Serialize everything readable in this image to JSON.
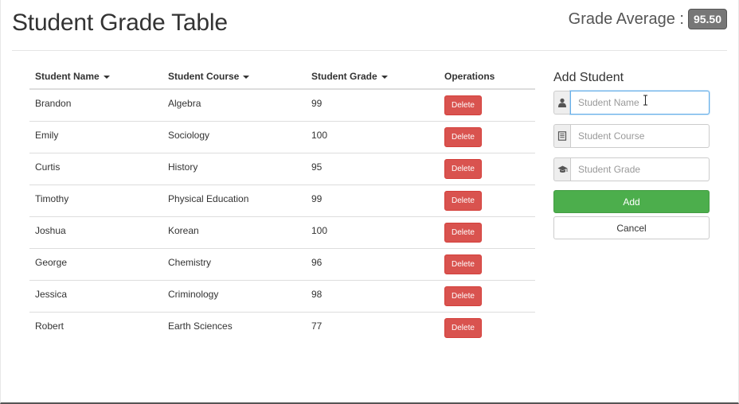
{
  "header": {
    "title": "Student Grade Table",
    "average_label": "Grade Average :",
    "average_value": "95.50"
  },
  "table": {
    "columns": [
      "Student Name",
      "Student Course",
      "Student Grade",
      "Operations"
    ],
    "rows": [
      {
        "name": "Brandon",
        "course": "Algebra",
        "grade": "99",
        "action": "Delete"
      },
      {
        "name": "Emily",
        "course": "Sociology",
        "grade": "100",
        "action": "Delete"
      },
      {
        "name": "Curtis",
        "course": "History",
        "grade": "95",
        "action": "Delete"
      },
      {
        "name": "Timothy",
        "course": "Physical Education",
        "grade": "99",
        "action": "Delete"
      },
      {
        "name": "Joshua",
        "course": "Korean",
        "grade": "100",
        "action": "Delete"
      },
      {
        "name": "George",
        "course": "Chemistry",
        "grade": "96",
        "action": "Delete"
      },
      {
        "name": "Jessica",
        "course": "Criminology",
        "grade": "98",
        "action": "Delete"
      },
      {
        "name": "Robert",
        "course": "Earth Sciences",
        "grade": "77",
        "action": "Delete"
      }
    ]
  },
  "form": {
    "title": "Add Student",
    "name_placeholder": "Student Name",
    "course_placeholder": "Student Course",
    "grade_placeholder": "Student Grade",
    "name_value": "",
    "course_value": "",
    "grade_value": "",
    "add_label": "Add",
    "cancel_label": "Cancel",
    "icons": [
      "user-icon",
      "list-alt-icon",
      "education-icon"
    ]
  },
  "colors": {
    "delete": "#d9534f",
    "add": "#4cae4c",
    "badge": "#777777"
  }
}
